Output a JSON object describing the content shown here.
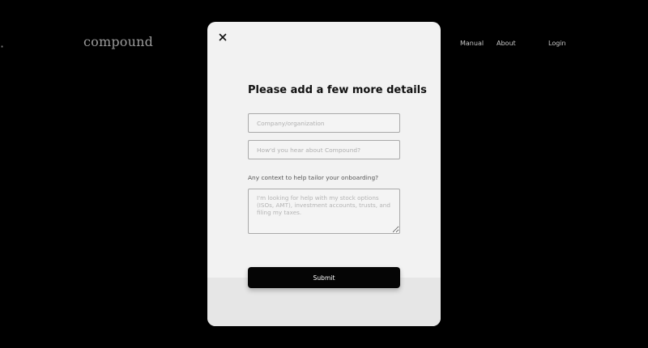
{
  "header": {
    "logo": "compound",
    "nav": {
      "manual": "Manual",
      "about": "About",
      "separator": "·",
      "login": "Login"
    }
  },
  "modal": {
    "close_icon": "close-icon",
    "title": "Please add a few more details",
    "company_field": {
      "value": "",
      "placeholder": "Company/organization"
    },
    "referral_field": {
      "value": "",
      "placeholder": "How'd you hear about Compound?"
    },
    "context_label": "Any context to help tailor your onboarding?",
    "context_field": {
      "value": "",
      "placeholder": "I'm looking for help with my stock options (ISOs, AMT), investment accounts, trusts, and filing my taxes."
    },
    "submit_label": "Submit"
  },
  "colors": {
    "background": "#000000",
    "modal": "#f2f2f2",
    "button": "#050505",
    "button_text": "#ffffff"
  }
}
